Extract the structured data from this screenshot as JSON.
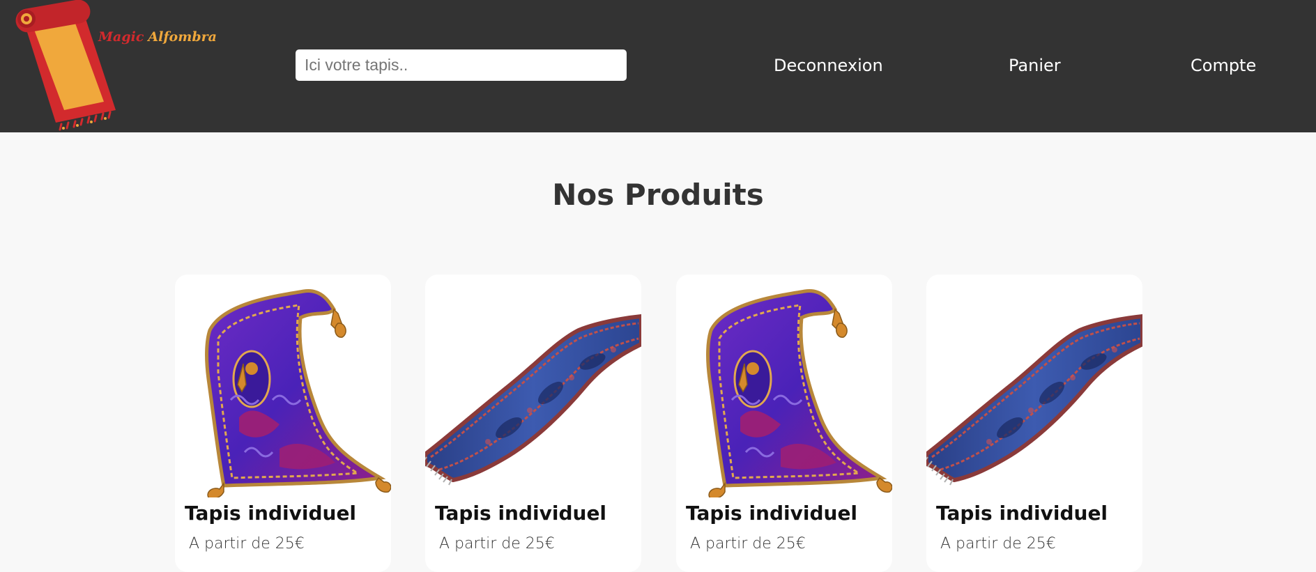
{
  "header": {
    "brand": {
      "word1": "Magic",
      "word2": "Alfombra"
    },
    "search": {
      "placeholder": "Ici votre tapis..",
      "value": ""
    },
    "nav": [
      {
        "label": "Deconnexion"
      },
      {
        "label": "Panier"
      },
      {
        "label": "Compte"
      }
    ]
  },
  "main": {
    "title": "Nos Produits",
    "products": [
      {
        "title": "Tapis individuel",
        "price": "A partir de 25€",
        "image": "purple-flying-carpet"
      },
      {
        "title": "Tapis individuel",
        "price": "A partir de 25€",
        "image": "blue-persian-carpet"
      },
      {
        "title": "Tapis individuel",
        "price": "A partir de 25€",
        "image": "purple-flying-carpet"
      },
      {
        "title": "Tapis individuel",
        "price": "A partir de 25€",
        "image": "blue-persian-carpet"
      }
    ]
  },
  "colors": {
    "header_bg": "#333333",
    "page_bg": "#f8f8f8",
    "brand_red": "#d22a2d",
    "brand_orange": "#f0a83c"
  }
}
